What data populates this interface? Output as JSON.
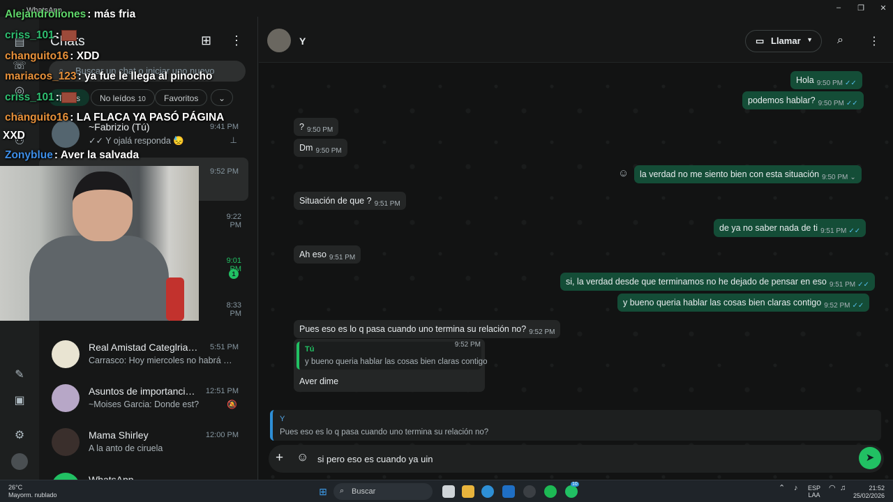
{
  "window": {
    "title": "WhatsApp",
    "min": "–",
    "max": "❐",
    "close": "✕"
  },
  "sidebar": {
    "title": "Chats",
    "search_placeholder": "Buscar un chat o iniciar uno nuevo",
    "filters": [
      {
        "label": "Todos"
      },
      {
        "label": "No leídos",
        "count": "10"
      },
      {
        "label": "Favoritos"
      }
    ],
    "chats": [
      {
        "name": "~Fabrizio (Tú)",
        "preview": "✓✓ Y ojalá responda 😓",
        "time": "9:41 PM",
        "pinned": true
      },
      {
        "time": "9:52 PM"
      },
      {
        "time": "9:22 PM"
      },
      {
        "time": "9:01 PM",
        "unread": "1"
      },
      {
        "time": "8:33 PM"
      },
      {
        "name": "Real Amistad Categlria 200...",
        "preview": "Carrasco: Hoy miercoles no habrá entr...",
        "time": "5:51 PM"
      },
      {
        "name": "Asuntos de importancias...",
        "preview": "~Moises Garcia: Donde est?",
        "time": "12:51 PM",
        "muted": true
      },
      {
        "name": "Mama Shirley",
        "preview": "A la anto de ciruela",
        "time": "12:00 PM"
      },
      {
        "name": "WhatsApp"
      }
    ]
  },
  "header": {
    "name": "Y",
    "call_label": "Llamar"
  },
  "messages": [
    {
      "dir": "out",
      "text": "Hola",
      "time": "9:50 PM",
      "ticks": "✓✓"
    },
    {
      "dir": "out",
      "text": "podemos hablar?",
      "time": "9:50 PM",
      "ticks": "✓✓"
    },
    {
      "dir": "in",
      "text": "?",
      "time": "9:50 PM"
    },
    {
      "dir": "in",
      "text": "Dm",
      "time": "9:50 PM"
    },
    {
      "dir": "out",
      "text": "la verdad no me siento bien con esta situación",
      "time": "9:50 PM",
      "ticks": "⌄"
    },
    {
      "dir": "in",
      "text": "Situación de que ?",
      "time": "9:51 PM"
    },
    {
      "dir": "out",
      "text": "de ya no saber nada de ti",
      "time": "9:51 PM",
      "ticks": "✓✓"
    },
    {
      "dir": "in",
      "text": "Ah eso",
      "time": "9:51 PM"
    },
    {
      "dir": "out",
      "text": "si, la verdad desde que terminamos no he dejado de pensar en eso",
      "time": "9:51 PM",
      "ticks": "✓✓"
    },
    {
      "dir": "out",
      "text": "y bueno queria hablar las cosas bien claras contigo",
      "time": "9:52 PM",
      "ticks": "✓✓"
    },
    {
      "dir": "in",
      "text": "Pues eso es lo q pasa cuando uno termina su relación no?",
      "time": "9:52 PM"
    },
    {
      "dir": "in",
      "text": "Aver dime",
      "time": "9:52 PM",
      "quote_author": "Tú",
      "quote_text": "y bueno queria hablar las cosas bien claras contigo"
    }
  ],
  "reply": {
    "author": "Y",
    "text": "Pues eso es lo q pasa cuando uno termina su relación no?"
  },
  "composer": {
    "value": "si pero eso es cuando ya uin"
  },
  "stream_chat": [
    {
      "user": "Alejandroliones",
      "text": ": más fria",
      "color": "#5fd66a"
    },
    {
      "user": "criss_101",
      "text": ":",
      "color": "#2fbf71",
      "emote": true
    },
    {
      "user": "changuito16",
      "text": ": XDD",
      "color": "#e8913a"
    },
    {
      "user": "mariacos_123",
      "text": ": ya fue le llega al pinocho",
      "color": "#e8913a"
    },
    {
      "user": "criss_101",
      "text": ":",
      "color": "#2fbf71",
      "emote": true
    },
    {
      "user": "changuito16",
      "text": ": LA FLACA YA PASÓ PÁGINA",
      "color": "#e8913a"
    },
    {
      "user": "",
      "text": "XXD",
      "color": "#ffffff"
    },
    {
      "user": "Zonyblue",
      "text": ": Aver la salvada",
      "color": "#3d8ee8"
    }
  ],
  "taskbar": {
    "weather_temp": "26°C",
    "weather_desc": "Mayorm. nublado",
    "search_label": "Buscar",
    "lang_1": "ESP",
    "lang_2": "LAA",
    "time": "21:52",
    "date": "25/02/2026",
    "wa_badge": "10"
  }
}
